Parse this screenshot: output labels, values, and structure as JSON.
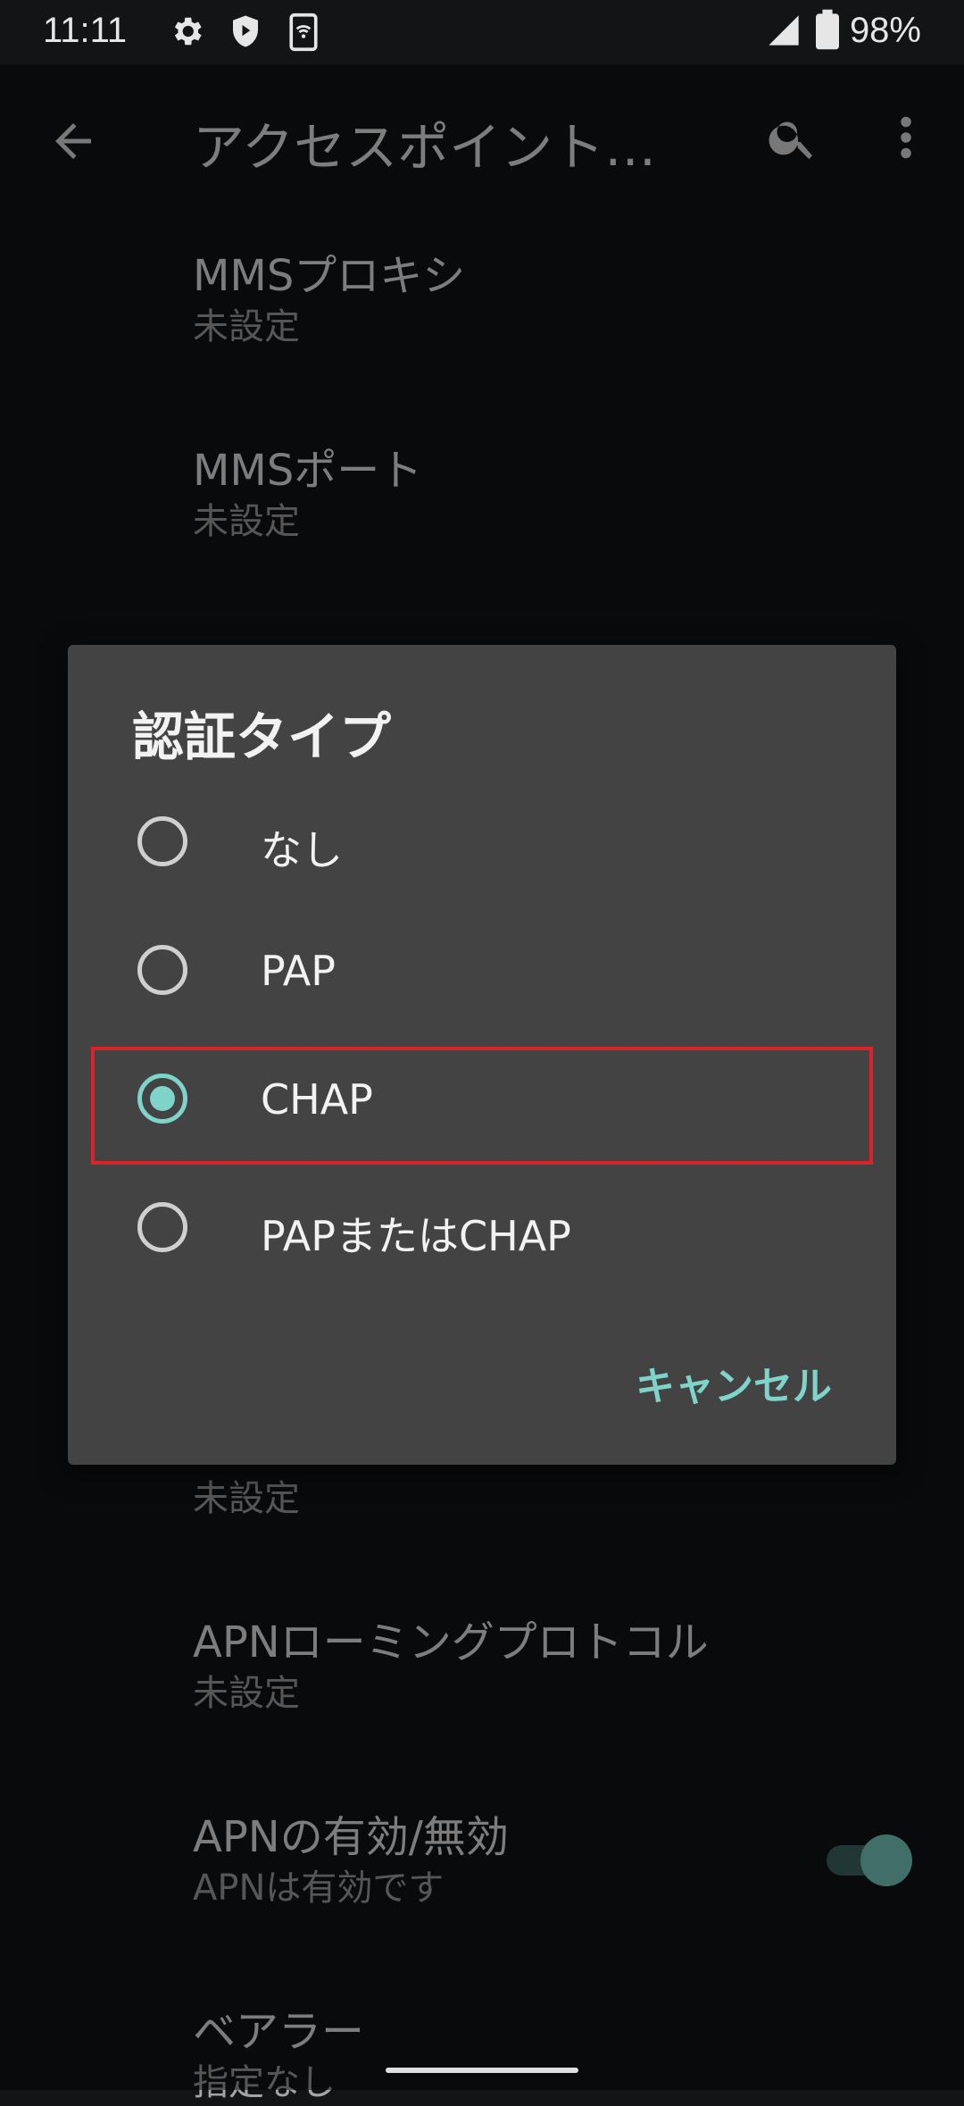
{
  "status_bar": {
    "time": "11:11",
    "icons": [
      "gear-icon",
      "shield-play-icon",
      "sim-wifi-icon",
      "signal-icon",
      "battery-icon"
    ],
    "battery": "98%"
  },
  "toolbar": {
    "title": "アクセスポイント…"
  },
  "preferences": [
    {
      "title": "MMSプロキシ",
      "summary": "未設定"
    },
    {
      "title": "MMSポート",
      "summary": "未設定"
    },
    {
      "title": "",
      "summary": "未設定"
    },
    {
      "title": "APNローミングプロトコル",
      "summary": "未設定"
    },
    {
      "title": "APNの有効/無効",
      "summary": "APNは有効です"
    },
    {
      "title": "ベアラー",
      "summary": "指定なし"
    }
  ],
  "apn_enabled": true,
  "dialog": {
    "title": "認証タイプ",
    "options": [
      {
        "label": "なし",
        "selected": false
      },
      {
        "label": "PAP",
        "selected": false
      },
      {
        "label": "CHAP",
        "selected": true
      },
      {
        "label": "PAPまたはCHAP",
        "selected": false
      }
    ],
    "cancel_label": "キャンセル"
  },
  "colors": {
    "accent": "#7fd4c9",
    "dialog_bg": "#434343",
    "highlight": "#d9222a",
    "background": "#121416"
  }
}
